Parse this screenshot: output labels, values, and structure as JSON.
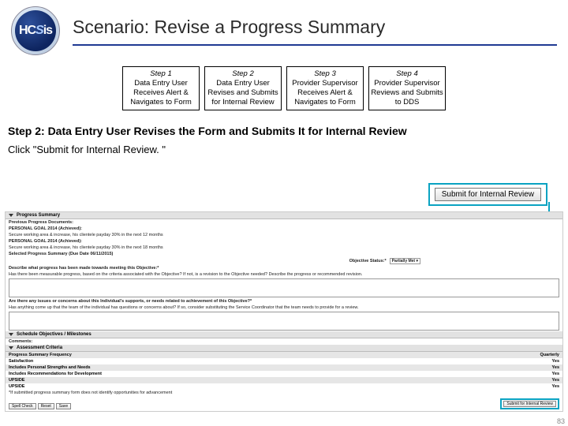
{
  "header": {
    "logo_text_hc": "HC",
    "logo_text_s": "S",
    "logo_text_is": "is",
    "title": "Scenario: Revise a Progress Summary"
  },
  "steps": [
    {
      "num": "Step 1",
      "text": "Data Entry User Receives Alert & Navigates to Form"
    },
    {
      "num": "Step 2",
      "text": "Data Entry User Revises and Submits for Internal Review"
    },
    {
      "num": "Step 3",
      "text": "Provider Supervisor Receives Alert & Navigates to Form"
    },
    {
      "num": "Step 4",
      "text": "Provider Supervisor Reviews and Submits to DDS"
    }
  ],
  "instruction_heading": "Step 2: Data Entry User Revises the Form and Submits It for Internal Review",
  "instruction_click": "Click \"Submit for Internal Review. \"",
  "submit_button_label": "Submit for Internal Review",
  "form": {
    "sec_progress_summary": "Progress Summary",
    "sec_previous_docs": "Previous Progress Documents:",
    "goal1_label": "PERSONAL GOAL 2014 (Achieved):",
    "goal1_text": "Secure working area & increase, his clientele payday 30% in the next 12 months",
    "goal2_label": "PERSONAL GOAL 2014 (Achieved):",
    "goal2_text": "Secure working area & increase, his clientele payday 30% in the next 18 months",
    "selected_summary": "Selected Progress Summary (Due Date 06/11/2015)",
    "obj_status_label": "Objective Status:*",
    "obj_status_value": "Partially Met ▾",
    "q1_label": "Describe what progress has been made towards meeting this Objective:*",
    "q1_hint": "Has there been measurable progress, based on the criteria associated with the Objective? If not, is a revision to the Objective needed? Describe the progress or recommended revision.",
    "q2_label": "Are there any issues or concerns about this Individual's supports, or needs related to achievement of this Objective?*",
    "q2_hint": "Has anything come up that the team of the individual has questions or concerns about? If so, consider substituting the Service Coordinator that the team needs to provide for a review.",
    "sec_schedule": "Schedule Objectives / Milestones",
    "comments": "Comments:",
    "sec_assessment": "Assessment Criteria",
    "rows": [
      {
        "label": "Progress Summary Frequency",
        "val": "Quarterly"
      },
      {
        "label": "Satisfaction",
        "val": "Yes"
      },
      {
        "label": "Includes Personal Strengths and Needs",
        "val": "Yes"
      },
      {
        "label": "Includes Recommendations for Development",
        "val": "Yes"
      },
      {
        "label": "UPSIDE",
        "val": "Yes"
      },
      {
        "label": "UPSIDE",
        "val": "Yes"
      }
    ],
    "footer_note": "*If submitted progress summary form does not identify opportunities for advancement",
    "btn_spellcheck": "Spell Check",
    "btn_reset": "Reset",
    "btn_save": "Save"
  },
  "page_number": "83"
}
